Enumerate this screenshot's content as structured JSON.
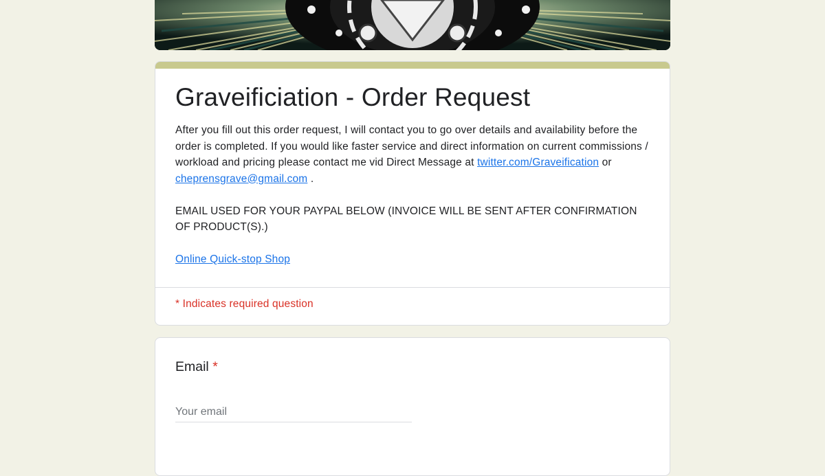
{
  "form": {
    "title": "Graveificiation - Order Request",
    "description": {
      "line1": "After you fill out this order request, I will contact you to go over details and availability before the order is completed. If you would like faster service and direct information on current commissions / workload and pricing please contact me vid Direct Message at ",
      "twitter_link": "twitter.com/Graveification",
      "or_text": " or ",
      "email_link": "cheprensgrave@gmail.com",
      "period": " .",
      "paypal_note": "EMAIL USED FOR YOUR PAYPAL BELOW (INVOICE WILL BE SENT AFTER CONFIRMATION OF PRODUCT(S).)",
      "shop_link": "Online Quick-stop Shop"
    },
    "required_note": "* Indicates required question"
  },
  "questions": [
    {
      "label": "Email",
      "required_mark": "*",
      "placeholder": "Your email",
      "value": ""
    }
  ],
  "colors": {
    "background": "#f2f2e6",
    "accent": "#c8c98e",
    "link": "#1a73e8",
    "required": "#d93025"
  }
}
